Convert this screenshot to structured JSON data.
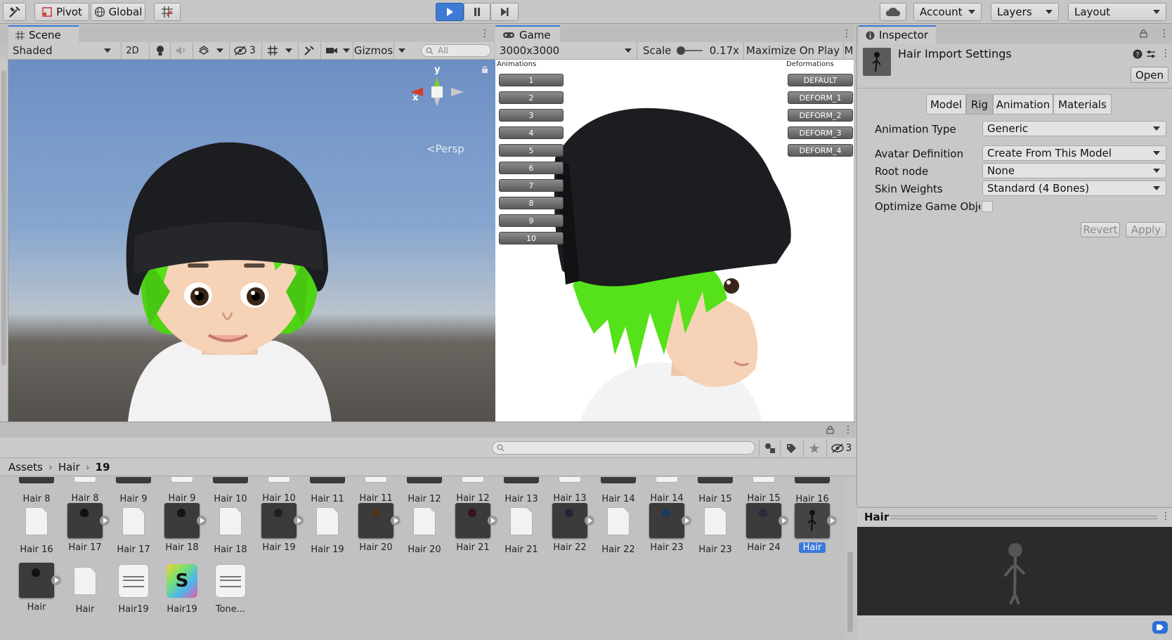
{
  "toolbar": {
    "pivot_label": "Pivot",
    "global_label": "Global",
    "account_label": "Account",
    "layers_label": "Layers",
    "layout_label": "Layout"
  },
  "scene": {
    "tab_label": "Scene",
    "shading_mode": "Shaded",
    "mode_2d": "2D",
    "hidden_count": "3",
    "gizmos_label": "Gizmos",
    "search_placeholder": "All",
    "persp_label": "<Persp",
    "axis_y": "y",
    "axis_x": "x"
  },
  "game": {
    "tab_label": "Game",
    "resolution": "3000x3000",
    "scale_label": "Scale",
    "scale_value": "0.17x",
    "maximize_label": "Maximize On Play",
    "truncated_label": "M",
    "animations_header": "Animations",
    "deformations_header": "Deformations",
    "animation_buttons": [
      "1",
      "2",
      "3",
      "4",
      "5",
      "6",
      "7",
      "8",
      "9",
      "10"
    ],
    "deformation_buttons": [
      "DEFAULT",
      "DEFORM_1",
      "DEFORM_2",
      "DEFORM_3",
      "DEFORM_4"
    ]
  },
  "inspector": {
    "tab_label": "Inspector",
    "title": "Hair Import Settings",
    "open_label": "Open",
    "tabs": [
      "Model",
      "Rig",
      "Animation",
      "Materials"
    ],
    "active_tab": "Rig",
    "fields": [
      {
        "label": "Animation Type",
        "value": "Generic"
      },
      {
        "label": "Avatar Definition",
        "value": "Create From This Model"
      },
      {
        "label": "Root node",
        "value": "None"
      },
      {
        "label": "Skin Weights",
        "value": "Standard (4 Bones)"
      }
    ],
    "optimize_label": "Optimize Game Objec",
    "revert_label": "Revert",
    "apply_label": "Apply",
    "preview_title": "Hair"
  },
  "project": {
    "hidden_count": "3",
    "breadcrumb": [
      "Assets",
      "Hair",
      "19"
    ],
    "row1": [
      "Hair 8",
      "Hair 8",
      "Hair 9",
      "Hair 9",
      "Hair 10",
      "Hair 10",
      "Hair 11",
      "Hair 11",
      "Hair 12",
      "Hair 12",
      "Hair 13",
      "Hair 13",
      "Hair 14",
      "Hair 14",
      "Hair 15",
      "Hair 15",
      "Hair 16"
    ],
    "row2": [
      {
        "label": "Hair 16",
        "kind": "file"
      },
      {
        "label": "Hair 17",
        "kind": "model",
        "color": "#111111"
      },
      {
        "label": "Hair 17",
        "kind": "file"
      },
      {
        "label": "Hair 18",
        "kind": "model",
        "color": "#151515"
      },
      {
        "label": "Hair 18",
        "kind": "file"
      },
      {
        "label": "Hair 19",
        "kind": "model",
        "color": "#202020"
      },
      {
        "label": "Hair 19",
        "kind": "file"
      },
      {
        "label": "Hair 20",
        "kind": "model",
        "color": "#4a3516"
      },
      {
        "label": "Hair 20",
        "kind": "file"
      },
      {
        "label": "Hair 21",
        "kind": "model",
        "color": "#3a1420"
      },
      {
        "label": "Hair 21",
        "kind": "file"
      },
      {
        "label": "Hair 22",
        "kind": "model",
        "color": "#24233a"
      },
      {
        "label": "Hair 22",
        "kind": "file"
      },
      {
        "label": "Hair 23",
        "kind": "model",
        "color": "#1d3a5a"
      },
      {
        "label": "Hair 23",
        "kind": "file"
      },
      {
        "label": "Hair 24",
        "kind": "model",
        "color": "#2a2a3a"
      },
      {
        "label": "Hair",
        "kind": "selected"
      }
    ],
    "row3": [
      {
        "label": "Hair",
        "kind": "model"
      },
      {
        "label": "Hair",
        "kind": "file"
      },
      {
        "label": "Hair19",
        "kind": "text"
      },
      {
        "label": "Hair19",
        "kind": "shader"
      },
      {
        "label": "Tone...",
        "kind": "text"
      }
    ],
    "shader_letter": "S"
  },
  "colors": {
    "accent": "#3a79d9",
    "play_active": "#3d7bd6",
    "hair_green": "#55e21a",
    "beanie": "#1c1d20"
  }
}
